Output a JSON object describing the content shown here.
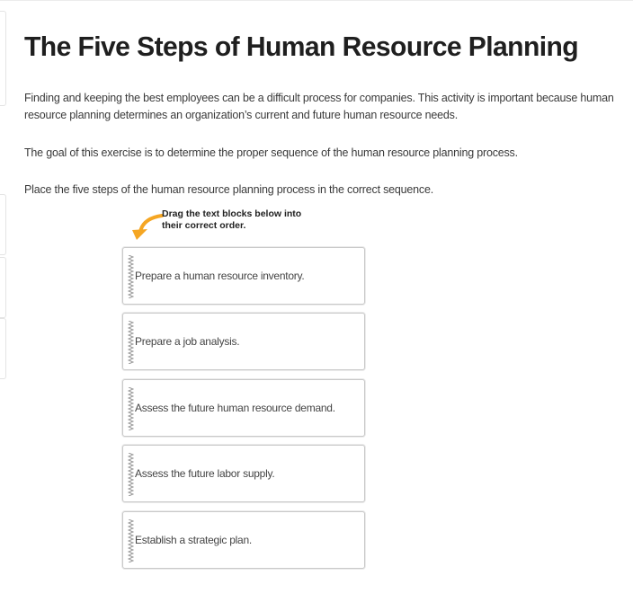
{
  "page": {
    "title": "The Five Steps of Human Resource Planning",
    "intro": "Finding and keeping the best employees can be a difficult process for companies. This activity is important because human resource planning determines an organization’s current and future human resource needs.",
    "goal": "The goal of this exercise is to determine the proper sequence of the human resource planning process.",
    "task": "Place the five steps of the human resource planning process in the correct sequence."
  },
  "activity": {
    "instruction": "Drag the text blocks below into their correct order.",
    "arrow_color": "#f5a623",
    "blocks": [
      {
        "label": "Prepare a human resource inventory."
      },
      {
        "label": "Prepare a job analysis."
      },
      {
        "label": "Assess the future human resource demand."
      },
      {
        "label": "Assess the future labor supply."
      },
      {
        "label": "Establish a strategic plan."
      }
    ]
  }
}
